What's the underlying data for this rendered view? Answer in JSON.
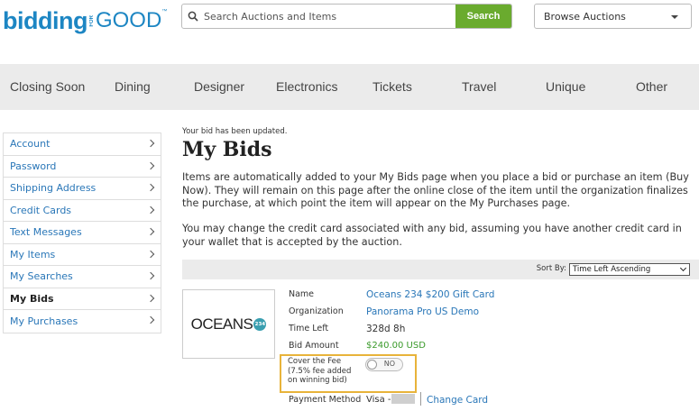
{
  "header": {
    "logo": {
      "bidding": "bidding",
      "for": "FOR",
      "good": "GOOD",
      "tm": "™"
    },
    "search": {
      "placeholder": "Search Auctions and Items",
      "button_label": "Search"
    },
    "browse": {
      "label": "Browse Auctions"
    }
  },
  "categories": [
    "Closing Soon",
    "Dining",
    "Designer",
    "Electronics",
    "Tickets",
    "Travel",
    "Unique",
    "Other"
  ],
  "sidebar": {
    "items": [
      {
        "label": "Account"
      },
      {
        "label": "Password"
      },
      {
        "label": "Shipping Address"
      },
      {
        "label": "Credit Cards"
      },
      {
        "label": "Text Messages"
      },
      {
        "label": "My Items"
      },
      {
        "label": "My Searches"
      },
      {
        "label": "My Bids",
        "active": true
      },
      {
        "label": "My Purchases"
      }
    ]
  },
  "main": {
    "notice": "Your bid has been updated.",
    "title": "My Bids",
    "paragraph1": "Items are automatically added to your My Bids page when you place a bid or purchase an item (Buy Now). They will remain on this page after the online close of the item until the organization finalizes the purchase, at which point the item will appear on the My Purchases page.",
    "paragraph2": "You may change the credit card associated with any bid, assuming you have another credit card in your wallet that is accepted by the auction.",
    "sort": {
      "label": "Sort By:",
      "selected": "Time Left Ascending"
    }
  },
  "item": {
    "thumb_text": "OCEANS",
    "thumb_badge": "234",
    "name_label": "Name",
    "name_value": "Oceans 234 $200 Gift Card",
    "org_label": "Organization",
    "org_value": "Panorama Pro US Demo",
    "time_label": "Time Left",
    "time_value": "328d 8h",
    "bid_label": "Bid Amount",
    "bid_value": "$240.00 USD",
    "fee_label_1": "Cover the Fee",
    "fee_label_2": "(7.5% fee added",
    "fee_label_3": "on winning bid)",
    "fee_toggle": "NO",
    "payment_label": "Payment Method",
    "payment_value": "Visa -",
    "change_card": "Change Card"
  },
  "colors": {
    "brand": "#1d86c3",
    "search_button": "#6aab2e",
    "highlight": "#e8b33a",
    "amount": "#3a9a2a"
  }
}
